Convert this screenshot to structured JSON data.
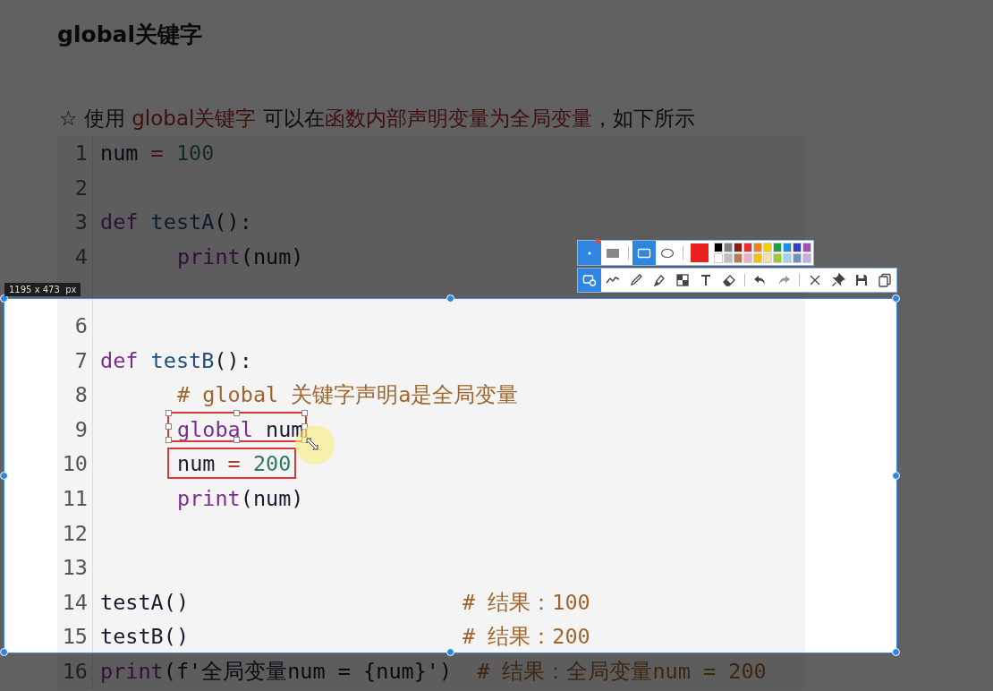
{
  "slide": {
    "title": "global关键字",
    "intro": [
      {
        "text": "☆ 使用 ",
        "kind": "plain"
      },
      {
        "text": "global关键字",
        "kind": "highlight"
      },
      {
        "text": " 可以在",
        "kind": "plain"
      },
      {
        "text": "函数内部声明变量为全局变量",
        "kind": "highlight"
      },
      {
        "text": "，如下所示",
        "kind": "plain"
      }
    ],
    "code": [
      {
        "kind": "code",
        "number": "1",
        "indented": false,
        "tokens": [
          {
            "text": "num ",
            "kind": "plain"
          },
          {
            "text": "= ",
            "kind": "operator"
          },
          {
            "text": "100",
            "kind": "number"
          }
        ]
      },
      {
        "kind": "blank",
        "number": "2"
      },
      {
        "kind": "code",
        "number": "3",
        "indented": false,
        "tokens": [
          {
            "text": "def ",
            "kind": "keyword"
          },
          {
            "text": "testA",
            "kind": "function"
          },
          {
            "text": "():",
            "kind": "plain"
          }
        ]
      },
      {
        "kind": "code",
        "number": "4",
        "indented": true,
        "tokens": [
          {
            "text": "print",
            "kind": "keyword"
          },
          {
            "text": "(num)",
            "kind": "plain"
          }
        ]
      },
      {
        "kind": "blank"
      },
      {
        "kind": "blank",
        "number": "6"
      },
      {
        "kind": "code",
        "number": "7",
        "indented": false,
        "tokens": [
          {
            "text": "def ",
            "kind": "keyword"
          },
          {
            "text": "testB",
            "kind": "function"
          },
          {
            "text": "():",
            "kind": "plain"
          }
        ]
      },
      {
        "kind": "code",
        "number": "8",
        "indented": true,
        "tokens": [
          {
            "text": "# global 关键字声明a是全局变量",
            "kind": "comment"
          }
        ]
      },
      {
        "kind": "code",
        "number": "9",
        "indented": true,
        "tokens": [
          {
            "text": "global",
            "kind": "keyword"
          },
          {
            "text": " num",
            "kind": "plain"
          }
        ],
        "annotation": {
          "selected": true
        }
      },
      {
        "kind": "code",
        "number": "10",
        "indented": true,
        "tokens": [
          {
            "text": "num ",
            "kind": "plain"
          },
          {
            "text": "= ",
            "kind": "operator"
          },
          {
            "text": "200",
            "kind": "number"
          }
        ],
        "annotation": {
          "selected": false
        }
      },
      {
        "kind": "code",
        "number": "11",
        "indented": true,
        "tokens": [
          {
            "text": "print",
            "kind": "keyword"
          },
          {
            "text": "(num)",
            "kind": "plain"
          }
        ]
      },
      {
        "kind": "blank",
        "number": "12"
      },
      {
        "kind": "blank",
        "number": "13"
      },
      {
        "kind": "code",
        "number": "14",
        "indented": false,
        "tokens": [
          {
            "text": "testA()",
            "kind": "plain"
          }
        ],
        "comment": "# 结果：100"
      },
      {
        "kind": "code",
        "number": "15",
        "indented": false,
        "tokens": [
          {
            "text": "testB()",
            "kind": "plain"
          }
        ],
        "comment": "# 结果：200"
      },
      {
        "kind": "code",
        "number": "16",
        "indented": false,
        "tokens": [
          {
            "text": "print",
            "kind": "keyword"
          },
          {
            "text": "(f'全局变量num = {num}')",
            "kind": "plain"
          }
        ],
        "comment": "# 结果：全局变量num = 200"
      }
    ]
  },
  "screenshot_tool": {
    "size_label": "1195 x 473  px",
    "shape_tools": [
      {
        "kind": "size",
        "selected": true
      },
      {
        "kind": "filled-rect",
        "selected": false
      },
      {
        "kind": "rect",
        "selected": true
      },
      {
        "kind": "ellipse",
        "selected": false
      }
    ],
    "current_color": {
      "color": "#e82020"
    },
    "palette": [
      {
        "color": "#000000"
      },
      {
        "color": "#808080"
      },
      {
        "color": "#8b1a1a"
      },
      {
        "color": "#e03030"
      },
      {
        "color": "#f08020"
      },
      {
        "color": "#f0d000"
      },
      {
        "color": "#20a040"
      },
      {
        "color": "#1890e0"
      },
      {
        "color": "#3040c0"
      },
      {
        "color": "#a050b0"
      },
      {
        "color": "#ffffff"
      },
      {
        "color": "#c0c0c0"
      },
      {
        "color": "#b87850"
      },
      {
        "color": "#f0b0c0"
      },
      {
        "color": "#f8c000"
      },
      {
        "color": "#f0e0b0"
      },
      {
        "color": "#a0c830"
      },
      {
        "color": "#a0d0f0"
      },
      {
        "color": "#7090c0"
      },
      {
        "color": "#c0b0e0"
      }
    ],
    "tools": [
      {
        "kind": "shape",
        "selected": true
      },
      {
        "kind": "line",
        "selected": false
      },
      {
        "kind": "pen",
        "selected": false
      },
      {
        "kind": "marker",
        "selected": false
      },
      {
        "kind": "mosaic",
        "selected": false
      },
      {
        "kind": "text",
        "selected": false
      },
      {
        "kind": "eraser",
        "selected": false
      },
      {
        "kind": "divider"
      },
      {
        "kind": "undo",
        "selected": false
      },
      {
        "kind": "redo",
        "selected": false
      },
      {
        "kind": "divider"
      },
      {
        "kind": "close",
        "selected": false
      },
      {
        "kind": "pin",
        "selected": false
      },
      {
        "kind": "save",
        "selected": false
      },
      {
        "kind": "copy",
        "selected": false
      }
    ]
  }
}
